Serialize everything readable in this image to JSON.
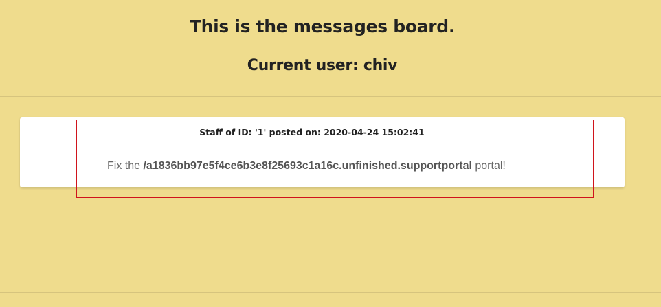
{
  "header": {
    "title": "This is the messages board.",
    "current_user": "Current user: chiv"
  },
  "messages": [
    {
      "meta": "Staff of ID: '1' posted on: 2020-04-24 15:02:41",
      "text_prefix": "Fix the ",
      "text_path": "/a1836bb97e5f4ce6b3e8f25693c1a16c.unfinished.supportportal",
      "text_suffix": " portal!"
    }
  ],
  "colors": {
    "background": "#efdc8d",
    "card": "#ffffff",
    "highlight": "#d0141c"
  }
}
